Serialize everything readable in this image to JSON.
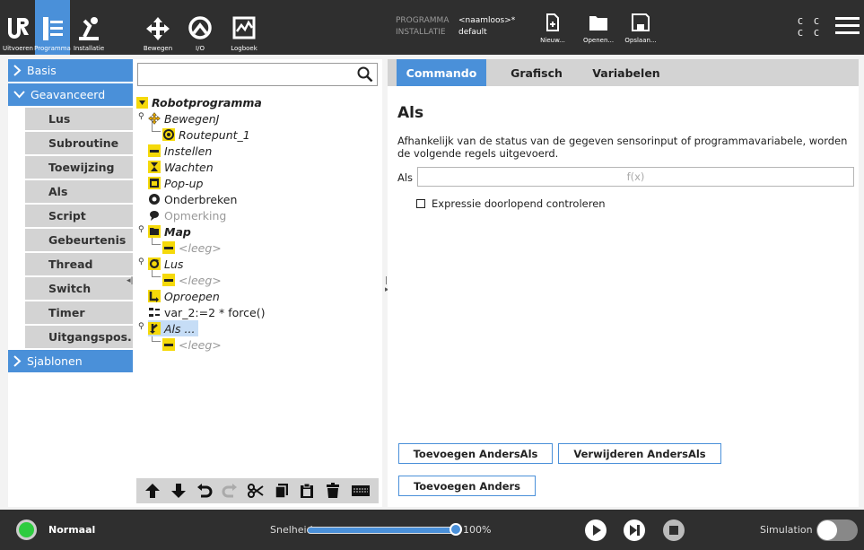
{
  "topnav": {
    "tabs": [
      {
        "label": "Uitvoeren",
        "icon": "ur-logo-icon"
      },
      {
        "label": "Programma",
        "icon": "program-tree-icon",
        "active": true
      },
      {
        "label": "Installatie",
        "icon": "installation-icon"
      },
      {
        "label": "Bewegen",
        "icon": "move-arrows-icon"
      },
      {
        "label": "I/O",
        "icon": "io-icon"
      },
      {
        "label": "Logboek",
        "icon": "log-chart-icon"
      }
    ]
  },
  "program_info": {
    "program_key": "PROGRAMMA",
    "program_value": "<naamloos>*",
    "installation_key": "INSTALLATIE",
    "installation_value": "default"
  },
  "file_actions": {
    "new": "Nieuw...",
    "open": "Openen...",
    "save": "Opslaan..."
  },
  "cc": {
    "row1": "C C",
    "row2": "C C"
  },
  "sidebar": {
    "basis": "Basis",
    "advanced": "Geavanceerd",
    "advanced_items": [
      "Lus",
      "Subroutine",
      "Toewijzing",
      "Als",
      "Script",
      "Gebeurtenis",
      "Thread",
      "Switch",
      "Timer",
      "Uitgangspos..."
    ],
    "templates": "Sjablonen"
  },
  "tree": {
    "root": "Robotprogramma",
    "items": {
      "moveJ": "BewegenJ",
      "waypoint": "Routepunt_1",
      "set": "Instellen",
      "wait": "Wachten",
      "popup": "Pop-up",
      "halt": "Onderbreken",
      "comment": "Opmerking",
      "folder": "Map",
      "empty1": "<leeg>",
      "loop": "Lus",
      "empty2": "<leeg>",
      "call": "Oproepen",
      "assign": "var_2:=2 * force()",
      "if": "Als ...",
      "empty3": "<leeg>"
    }
  },
  "right_tabs": [
    "Commando",
    "Grafisch",
    "Variabelen"
  ],
  "command": {
    "title": "Als",
    "description": "Afhankelijk van de status van de gegeven sensorinput of programmavariabele, worden de volgende regels uitgevoerd.",
    "als_label": "Als",
    "expression_placeholder": "f(x)",
    "checkbox_label": "Expressie doorlopend controleren",
    "btn_add_elseif": "Toevoegen AndersAls",
    "btn_remove_elseif": "Verwijderen AndersAls",
    "btn_add_else": "Toevoegen Anders"
  },
  "footer": {
    "status": "Normaal",
    "speed_label": "Snelheid",
    "speed_value": "100%",
    "speed_fraction": 1.0,
    "simulation_label": "Simulation"
  },
  "colors": {
    "accent": "#4a90d9",
    "bar": "#2f2f2f",
    "status_ok": "#2ecc40"
  }
}
